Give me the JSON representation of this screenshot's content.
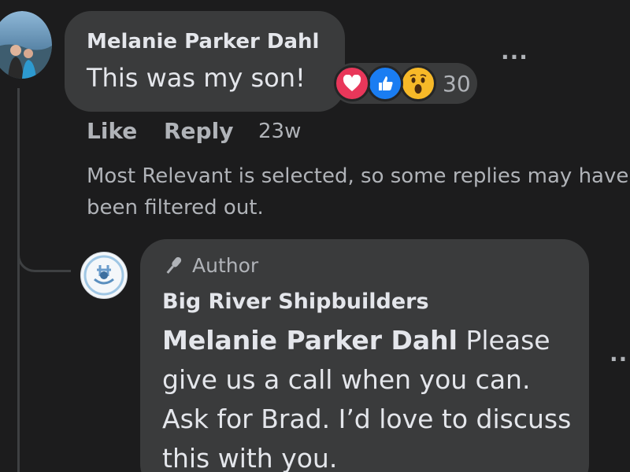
{
  "comment": {
    "author": "Melanie Parker Dahl",
    "text": "This was my son!",
    "reaction_count": "30",
    "reactions": [
      "love-icon",
      "like-icon",
      "wow-icon"
    ],
    "actions": {
      "like": "Like",
      "reply": "Reply",
      "time": "23w"
    }
  },
  "notice": "Most Relevant is selected, so some replies may have been filtered out.",
  "reply": {
    "badge": "Author",
    "author": "Big River Shipbuilders",
    "mention": "Melanie Parker Dahl",
    "text": " Please give us a call when you can. Ask for Brad. I’d love to discuss this with you."
  },
  "more_label": "···",
  "colors": {
    "background": "#1c1c1d",
    "bubble": "#3a3b3c",
    "text_primary": "#e4e6eb",
    "text_secondary": "#b0b3b8",
    "love": "#e8375a",
    "like": "#1a7df2",
    "wow": "#f7b928"
  }
}
